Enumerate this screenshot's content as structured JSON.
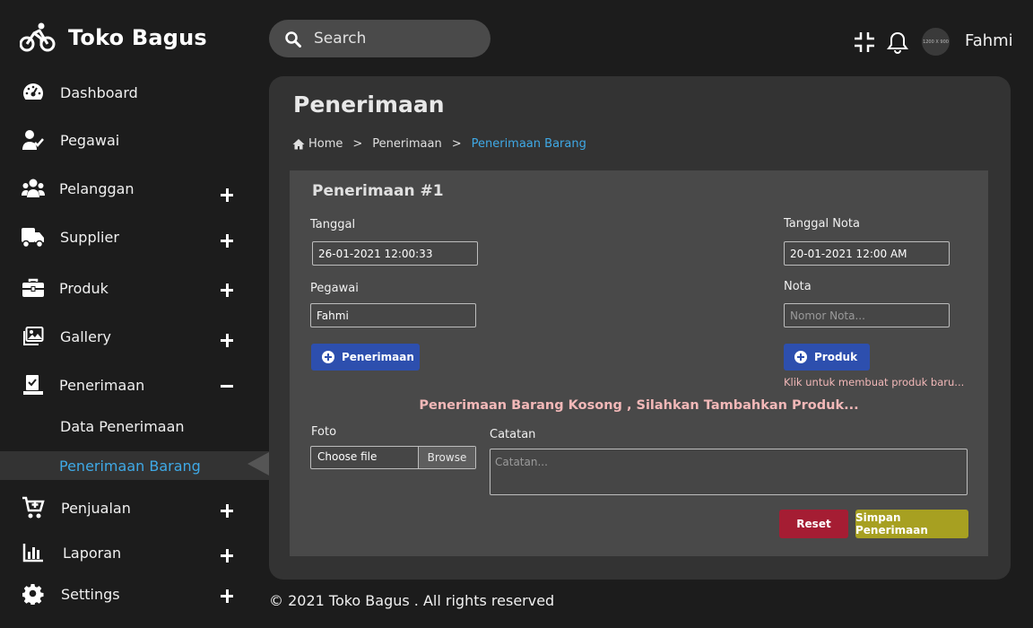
{
  "brand": {
    "name": "Toko Bagus"
  },
  "sidebar": {
    "items": [
      {
        "label": "Dashboard",
        "icon": "dashboard-gauge-icon",
        "toggle": "none"
      },
      {
        "label": "Pegawai",
        "icon": "user-check-icon",
        "toggle": "none"
      },
      {
        "label": "Pelanggan",
        "icon": "users-group-icon",
        "toggle": "plus"
      },
      {
        "label": "Supplier",
        "icon": "truck-icon",
        "toggle": "plus"
      },
      {
        "label": "Produk",
        "icon": "briefcase-icon",
        "toggle": "plus"
      },
      {
        "label": "Gallery",
        "icon": "images-icon",
        "toggle": "plus"
      },
      {
        "label": "Penerimaan",
        "icon": "clipboard-check-icon",
        "toggle": "minus"
      },
      {
        "label": "Penjualan",
        "icon": "cart-plus-icon",
        "toggle": "plus"
      },
      {
        "label": "Laporan",
        "icon": "bar-chart-icon",
        "toggle": "plus"
      },
      {
        "label": "Settings",
        "icon": "gear-icon",
        "toggle": "plus"
      }
    ],
    "subitems": [
      {
        "label": "Data Penerimaan",
        "active": false
      },
      {
        "label": "Penerimaan Barang",
        "active": true
      }
    ]
  },
  "topbar": {
    "search_label": "Search",
    "avatar_text": "1200 X 900",
    "user_name": "Fahmi"
  },
  "page": {
    "title": "Penerimaan",
    "breadcrumb": {
      "home": "Home",
      "sep": ">",
      "parent": "Penerimaan",
      "current": "Penerimaan Barang"
    }
  },
  "form": {
    "title": "Penerimaan #1",
    "tanggal_label": "Tanggal",
    "tanggal_value": "26-01-2021 12:00:33",
    "tanggal_nota_label": "Tanggal Nota",
    "tanggal_nota_value": "20-01-2021 12:00 AM",
    "pegawai_label": "Pegawai",
    "pegawai_value": "Fahmi",
    "nota_label": "Nota",
    "nota_placeholder": "Nomor Nota...",
    "penerimaan_button": "Penerimaan",
    "produk_button": "Produk",
    "produk_hint": "Klik untuk membuat produk baru...",
    "empty_message": "Penerimaan Barang Kosong , Silahkan Tambahkan Produk...",
    "foto_label": "Foto",
    "file_text": "Choose file",
    "browse_label": "Browse",
    "catatan_label": "Catatan",
    "catatan_placeholder": "Catatan...",
    "reset_button": "Reset",
    "save_button": "Simpan Penerimaan"
  },
  "footer": {
    "text": "© 2021 Toko Bagus . All rights reserved"
  },
  "colors": {
    "background": "#1c1c1c",
    "panel": "#333333",
    "card": "#494949",
    "accent_blue": "#3fa9e6",
    "button_blue": "#2d4fae",
    "button_red": "#a51d33",
    "button_olive": "#a7a021",
    "hint_pink": "#f2b8b8"
  }
}
